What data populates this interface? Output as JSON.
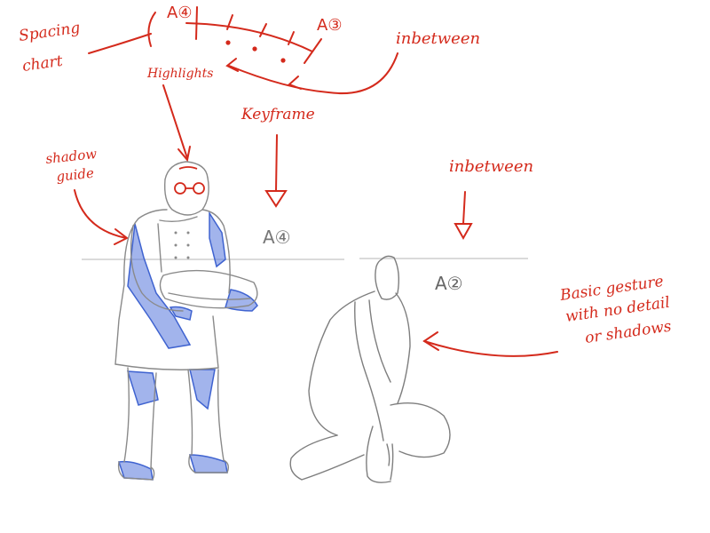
{
  "colors": {
    "annotation": "#d42a1c",
    "pencil": "#7a7a7a",
    "shadow": "#5577dd",
    "horizon": "#bdbdbd"
  },
  "spacing_chart": {
    "label_line1": "Spacing",
    "label_line2": "chart",
    "start_key": "A④",
    "end_key": "A③",
    "highlights_label": "Highlights",
    "inbetween_label": "inbetween"
  },
  "keyframe": {
    "label": "Keyframe",
    "drawing_key": "A④"
  },
  "inbetween": {
    "label": "inbetween",
    "drawing_key": "A②"
  },
  "shadow_guide": {
    "label_line1": "shadow",
    "label_line2": "guide"
  },
  "gesture_note": {
    "line1": "Basic gesture",
    "line2": "with no detail",
    "line3": "or shadows"
  }
}
